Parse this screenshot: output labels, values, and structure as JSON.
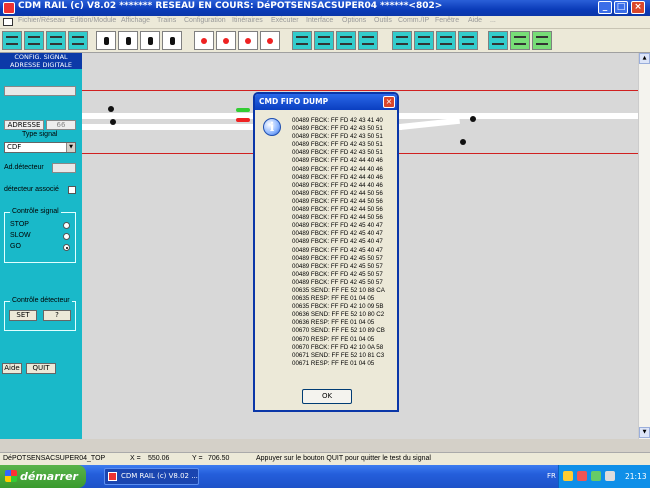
{
  "window": {
    "title": "CDM RAIL (c) V8.02      ******* RESEAU EN COURS: DéPOTSENSACSUPER04 ******<802>",
    "controls": {
      "minimize": "_",
      "maximize": "□",
      "close": "×"
    }
  },
  "menu": [
    "Fichier/Réseau",
    "Edition/Module",
    "Affichage",
    "Trains",
    "Configuration",
    "Itinéraires",
    "Exécuter",
    "Interface",
    "Options",
    "Outils",
    "Comm./IP",
    "Fenêtre",
    "Aide",
    "..."
  ],
  "panel": {
    "header": [
      "CONFIG. SIGNAL",
      "ADRESSE DIGITALE"
    ],
    "tabs": {
      "adresse": "ADRESSE",
      "second": "66"
    },
    "type_signal_label": "Type signal",
    "type_signal_value": "CDF",
    "ad_detecteur_label": "Ad.détecteur",
    "detecteur_associe_label": "détecteur associé",
    "controle_signal": {
      "title": "Contrôle signal",
      "options": [
        "STOP",
        "SLOW",
        "GO"
      ],
      "selected": "GO"
    },
    "controle_detecteur": {
      "title": "Contrôle détecteur",
      "set": "SET",
      "question": "?"
    },
    "aide": "Aide",
    "quit": "QUIT"
  },
  "dialog": {
    "title": "CMD FIFO DUMP",
    "close": "×",
    "icon": "info-icon",
    "lines": [
      "00489 FBCK: FF FD 42 43 41 40",
      "00489 FBCK: FF FD 42 43 50 51",
      "00489 FBCK: FF FD 42 43 50 51",
      "00489 FBCK: FF FD 42 43 50 51",
      "00489 FBCK: FF FD 42 43 50 51",
      "00489 FBCK: FF FD 42 44 40 46",
      "00489 FBCK: FF FD 42 44 40 46",
      "00489 FBCK: FF FD 42 44 40 46",
      "00489 FBCK: FF FD 42 44 40 46",
      "00489 FBCK: FF FD 42 44 50 56",
      "00489 FBCK: FF FD 42 44 50 56",
      "00489 FBCK: FF FD 42 44 50 56",
      "00489 FBCK: FF FD 42 44 50 56",
      "00489 FBCK: FF FD 42 45 40 47",
      "00489 FBCK: FF FD 42 45 40 47",
      "00489 FBCK: FF FD 42 45 40 47",
      "00489 FBCK: FF FD 42 45 40 47",
      "00489 FBCK: FF FD 42 45 50 57",
      "00489 FBCK: FF FD 42 45 50 57",
      "00489 FBCK: FF FD 42 45 50 57",
      "00489 FBCK: FF FD 42 45 50 57",
      "00635 SEND: FF FE 52 10 88 CA",
      "00635 RESP: FF FE 01 04 05",
      "00635 FBCK: FF FD 42 10 09 5B",
      "00636 SEND: FF FE 52 10 80 C2",
      "00636 RESP: FF FE 01 04 05",
      "00670 SEND: FF FE 52 10 89 CB",
      "00670 RESP: FF FE 01 04 05",
      "00670 FBCK: FF FD 42 10 0A 58",
      "00671 SEND: FF FE 52 10 81 C3",
      "00671 RESP: FF FE 01 04 05"
    ],
    "ok": "OK"
  },
  "status": {
    "module": "DéPOTSENSACSUPER04_TOP",
    "x_label": "X =",
    "x_value": "550.06",
    "y_label": "Y =",
    "y_value": "706.50",
    "message": "Appuyer sur le bouton QUIT pour quitter le test du signal"
  },
  "taskbar": {
    "start": "démarrer",
    "task": "CDM RAIL (c) V8.02 ...",
    "lang": "FR",
    "clock": "21:13"
  }
}
